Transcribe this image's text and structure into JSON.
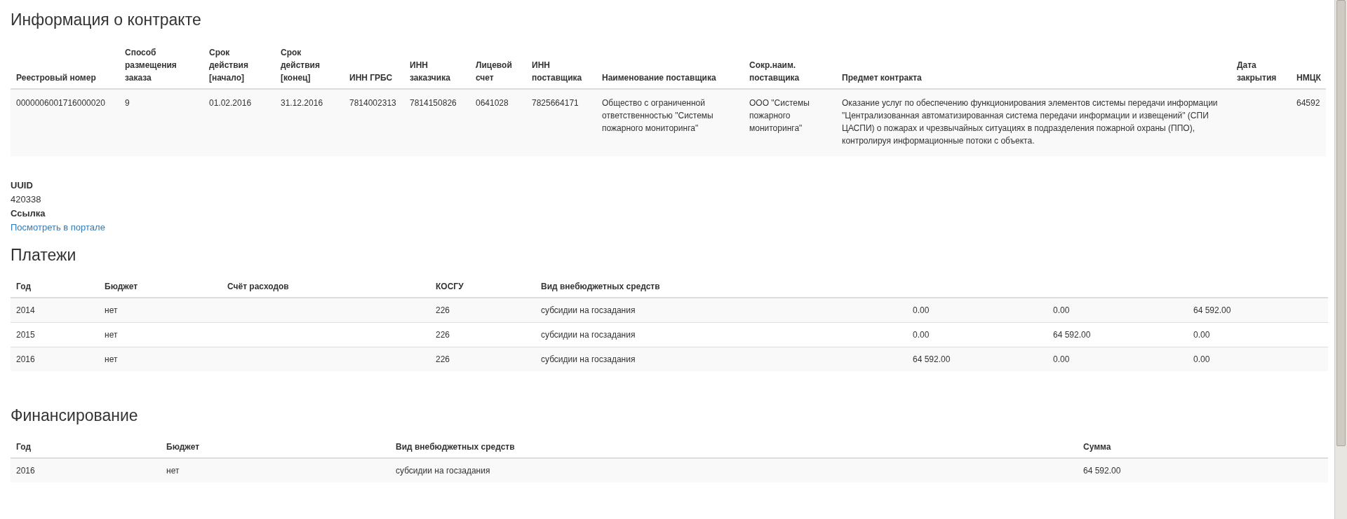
{
  "contract": {
    "title": "Информация о контракте",
    "columns": [
      "Реестровый номер",
      "Способ размещения заказа",
      "Срок действия [начало]",
      "Срок действия [конец]",
      "ИНН ГРБС",
      "ИНН заказчика",
      "Лицевой счет",
      "ИНН поставщика",
      "Наименование поставщика",
      "Сокр.наим. поставщика",
      "Предмет контракта",
      "Дата закрытия",
      "НМЦК"
    ],
    "rows": [
      {
        "cells": [
          "0000006001716000020",
          "9",
          "01.02.2016",
          "31.12.2016",
          "7814002313",
          "7814150826",
          "0641028",
          "7825664171",
          "Общество с ограниченной ответственностью \"Системы пожарного мониторинга\"",
          "ООО \"Системы пожарного мониторинга\"",
          "Оказание услуг по обеспечению функционирования элементов системы передачи информации \"Централизованная автоматизированная система передачи информации и извещений\" (СПИ ЦАСПИ) о пожарах и чрезвычайных ситуациях в подразделения пожарной охраны (ППО), контролируя информационные потоки с объекта.",
          "",
          "64592"
        ]
      }
    ]
  },
  "details": [
    {
      "label": "UUID",
      "value": "420338",
      "kind": "text"
    },
    {
      "label": "Ссылка",
      "value": "Посмотреть в портале",
      "kind": "link"
    }
  ],
  "payments": {
    "title": "Платежи",
    "columns": [
      "Год",
      "Бюджет",
      "Счёт расходов",
      "КОСГУ",
      "Вид внебюджетных средств",
      "",
      "",
      ""
    ],
    "rows": [
      {
        "cells": [
          "2014",
          "нет",
          "",
          "226",
          "субсидии на госзадания",
          "0.00",
          "0.00",
          "64 592.00"
        ]
      },
      {
        "cells": [
          "2015",
          "нет",
          "",
          "226",
          "субсидии на госзадания",
          "0.00",
          "64 592.00",
          "0.00"
        ]
      },
      {
        "cells": [
          "2016",
          "нет",
          "",
          "226",
          "субсидии на госзадания",
          "64 592.00",
          "0.00",
          "0.00"
        ]
      }
    ]
  },
  "financing": {
    "title": "Финансирование",
    "columns": [
      "Год",
      "Бюджет",
      "Вид внебюджетных средств",
      "Сумма"
    ],
    "rows": [
      {
        "cells": [
          "2016",
          "нет",
          "субсидии на госзадания",
          "64 592.00"
        ]
      }
    ]
  }
}
